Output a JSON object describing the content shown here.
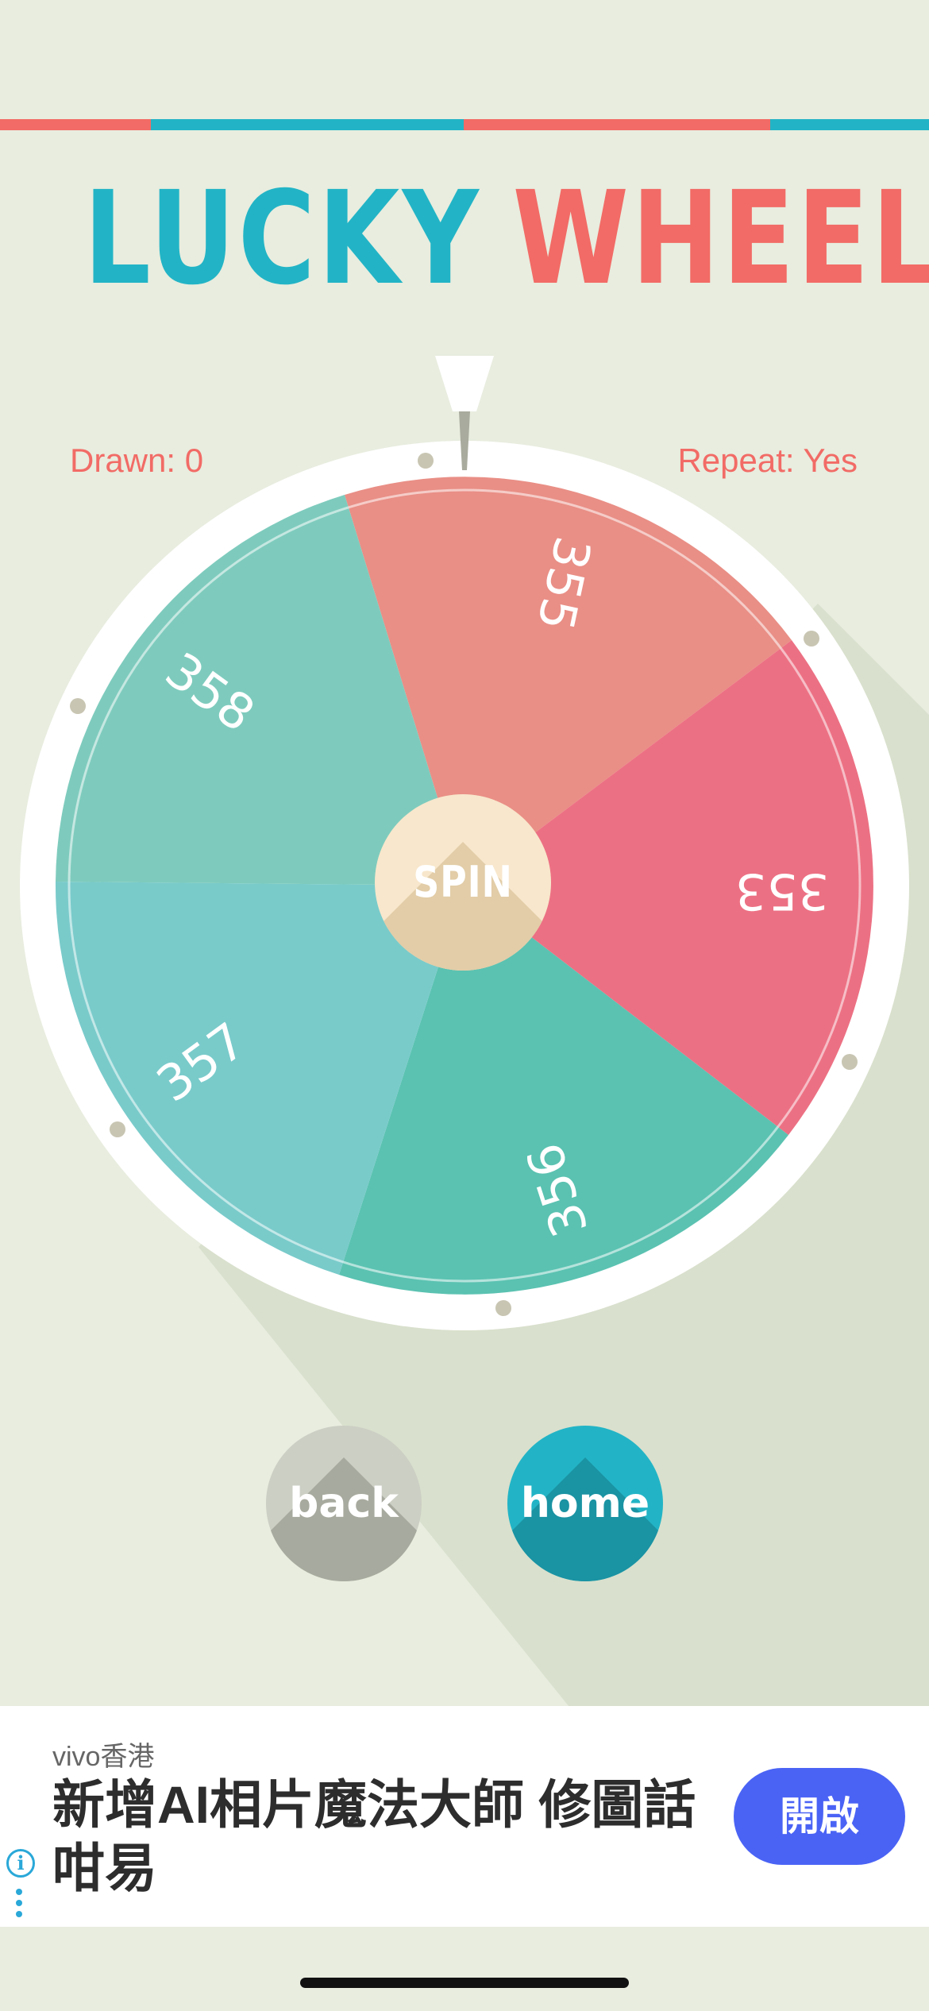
{
  "colors": {
    "background": "#e8eddf",
    "teal": "#22b4c6",
    "coral": "#f26b66",
    "seg_355": "#e98f86",
    "seg_353": "#ec7083",
    "seg_356": "#5bc2b1",
    "seg_357": "#79cbca",
    "seg_358": "#7ecbbd",
    "back_button": "#cccfc4",
    "home_button": "#22b4c6",
    "ad_button": "#4a63f5"
  },
  "header": {
    "title_part1": "LUCKY",
    "title_part2": "WHEEL"
  },
  "stats": {
    "drawn": "Drawn: 0",
    "repeat": "Repeat: Yes"
  },
  "wheel": {
    "segments": [
      {
        "label": "355"
      },
      {
        "label": "353"
      },
      {
        "label": "356"
      },
      {
        "label": "357"
      },
      {
        "label": "358"
      }
    ],
    "spin_label": "SPIN"
  },
  "buttons": {
    "back": "back",
    "home": "home"
  },
  "ad": {
    "advertiser": "vivo香港",
    "headline": "新增AI相片魔法大師 修圖話咁易",
    "cta": "開啟",
    "info_icon": "i"
  }
}
